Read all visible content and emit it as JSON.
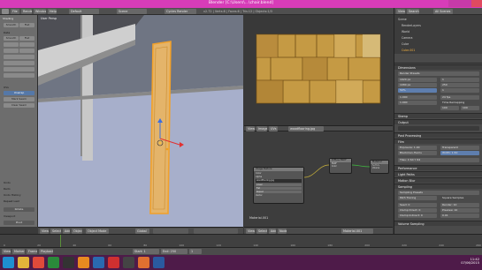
{
  "window": {
    "title": "Blender [C:\\Users\\...\\chair.blend]",
    "controls": [
      "minimize-icon",
      "maximize-icon",
      "close-icon"
    ]
  },
  "topbar": {
    "menus": [
      "File",
      "Render",
      "Window",
      "Help"
    ],
    "layout": "Default",
    "scene": "Scene",
    "engine": "Cycles Render",
    "stats": "v2.72 | Verts:8 | Faces:6 | Tris:12 | Objects:1/3"
  },
  "toolshelf": {
    "header": "Shading",
    "shading_buttons": [
      "Smooth",
      "Flat"
    ],
    "data_label": "Data",
    "data_buttons": [
      "Smooth",
      "Flat"
    ],
    "uv_label": "UVs",
    "uv_buttons": [
      "Unwrap",
      "Mark Seam",
      "Clear Seam"
    ],
    "history": [
      "Undo",
      "Redo",
      "Undo History",
      "Repeat Last"
    ],
    "bottom_labels": [
      "Rotate",
      "Viewport",
      "Pivot",
      "Triangle"
    ]
  },
  "viewport": {
    "label": "User Persp",
    "header_items": [
      "View",
      "Select",
      "Add",
      "Object",
      "Object Mode",
      "Global"
    ]
  },
  "image_editor": {
    "header_items": [
      "View",
      "Image",
      "UVs",
      "woodflooring.jpg"
    ]
  },
  "node_editor": {
    "frame_label": "Material.001",
    "nodes": [
      {
        "name": "Image Texture",
        "fields": [
          "Color",
          "Alpha",
          "woodflooring.jpg",
          "Linear",
          "Flat",
          "Repeat",
          "Vector"
        ]
      },
      {
        "name": "Diffuse BSDF",
        "fields": [
          "BSDF",
          "Color",
          "Roughness",
          "Normal"
        ]
      },
      {
        "name": "Material Output",
        "fields": [
          "Surface",
          "Volume",
          "Displacement"
        ]
      }
    ],
    "header_items": [
      "View",
      "Select",
      "Add",
      "Node",
      "Material.001"
    ]
  },
  "outliner": {
    "header": [
      "View",
      "Search",
      "All Scenes"
    ],
    "items": [
      "Scene",
      "RenderLayers",
      "World",
      "Camera",
      "Cube",
      "Cube.001"
    ]
  },
  "properties": {
    "sections": [
      "Dimensions",
      "Stamp",
      "Output",
      "Post Processing",
      "Film",
      "Performance",
      "Light Paths",
      "Motion Blur",
      "Sampling",
      "Volume Sampling"
    ],
    "render_presets": "Render Presets",
    "resolution_x": "1920 px",
    "resolution_y": "1080 px",
    "resolution_pct": "50%",
    "frame_start": "1",
    "end_frame": "250",
    "frame_step": "1",
    "frame_rate": "24 fps",
    "time_remapping": "Time Remapping",
    "aspect_x": "1.000",
    "aspect_y": "1.000",
    "old": "100",
    "new": "100",
    "sampling_presets": "Sampling Presets",
    "integrator": "Path Tracing",
    "square_samples": "Square Samples",
    "seed": "Seed: 0",
    "render_samples": "Render: 10",
    "preview_samples": "Preview: 10",
    "clamp_direct": "Clamp Direct: 0",
    "clamp_indirect": "Clamp Indirect: 0",
    "light_sampling_threshold": "0.01",
    "film_exposure": "Exposure: 1.00",
    "pixel_filter": "Blackman-Harris",
    "transparent": "Transparent",
    "width": "Width: 1.50",
    "tiles": "Tiles: X 64 Y 64"
  },
  "timeline": {
    "start": "Start: 1",
    "end": "End: 250",
    "current": "1",
    "items": [
      "View",
      "Marker",
      "Frame",
      "Playback"
    ],
    "ticks": [
      "0",
      "20",
      "40",
      "60",
      "80",
      "100",
      "120",
      "140",
      "160",
      "180",
      "200",
      "220",
      "240",
      "260"
    ]
  },
  "taskbar": {
    "time": "11:42",
    "date": "07/06/2015",
    "apps": [
      "ie-icon",
      "folder-icon",
      "chrome-icon",
      "media-icon",
      "blender-icon",
      "paint-icon",
      "photoshop-icon",
      "vlc-icon",
      "firefox-icon",
      "word-icon",
      "explorer-icon"
    ]
  },
  "colors": {
    "title_bar": "#d73cb8",
    "taskbar": "#4e1b49",
    "selection_orange": "#e8a020",
    "wood_light": "#c59a44",
    "wood_dark": "#7a5a22",
    "floor_blue": "#a8b0cc"
  }
}
